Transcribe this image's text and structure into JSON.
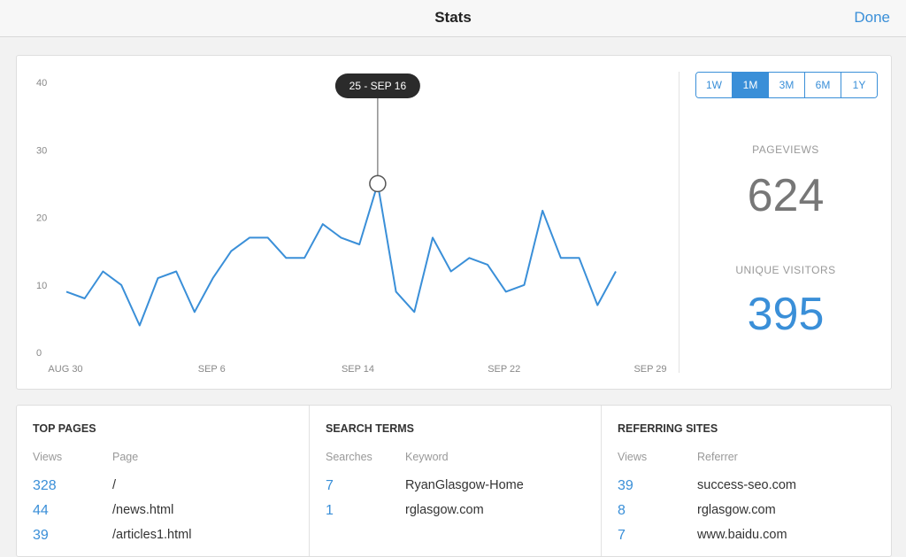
{
  "header": {
    "title": "Stats",
    "done_label": "Done"
  },
  "range": {
    "options": [
      "1W",
      "1M",
      "3M",
      "6M",
      "1Y"
    ],
    "selected": "1M"
  },
  "metrics": {
    "pageviews_label": "PAGEVIEWS",
    "pageviews_value": "624",
    "visitors_label": "UNIQUE VISITORS",
    "visitors_value": "395"
  },
  "chart_data": {
    "type": "line",
    "y_ticks": [
      0,
      10,
      20,
      30,
      40
    ],
    "ylim": [
      0,
      40
    ],
    "x_tick_labels": [
      "AUG 30",
      "SEP 6",
      "SEP 14",
      "SEP 22",
      "SEP 29"
    ],
    "values": [
      9,
      8,
      12,
      10,
      4,
      11,
      12,
      6,
      11,
      15,
      17,
      17,
      14,
      14,
      19,
      17,
      16,
      25,
      9,
      6,
      17,
      12,
      14,
      13,
      9,
      10,
      21,
      14,
      14,
      7,
      12
    ],
    "highlight_index": 17,
    "tooltip": "25 - SEP 16",
    "color": "#3a8fd8"
  },
  "top_pages": {
    "title": "TOP PAGES",
    "headers": [
      "Views",
      "Page"
    ],
    "rows": [
      {
        "views": "328",
        "label": "/"
      },
      {
        "views": "44",
        "label": "/news.html"
      },
      {
        "views": "39",
        "label": "/articles1.html"
      }
    ]
  },
  "search_terms": {
    "title": "SEARCH TERMS",
    "headers": [
      "Searches",
      "Keyword"
    ],
    "rows": [
      {
        "views": "7",
        "label": "RyanGlasgow-Home"
      },
      {
        "views": "1",
        "label": "rglasgow.com"
      }
    ]
  },
  "referring_sites": {
    "title": "REFERRING SITES",
    "headers": [
      "Views",
      "Referrer"
    ],
    "rows": [
      {
        "views": "39",
        "label": "success-seo.com"
      },
      {
        "views": "8",
        "label": "rglasgow.com"
      },
      {
        "views": "7",
        "label": "www.baidu.com"
      }
    ]
  },
  "colors": {
    "accent": "#3a8fd8",
    "muted": "#999999",
    "tooltip_bg": "#2b2b2b"
  }
}
